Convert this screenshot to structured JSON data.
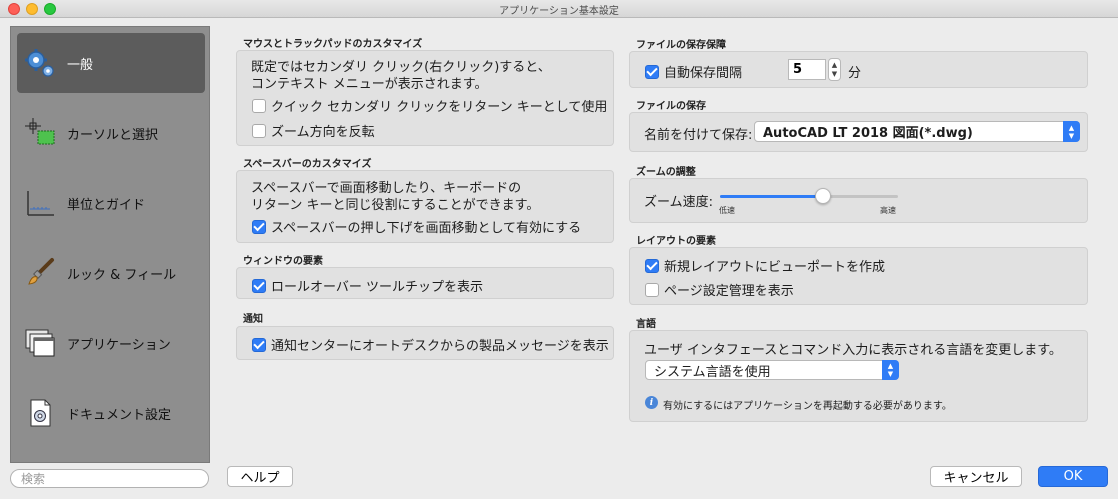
{
  "window": {
    "title": "アプリケーション基本設定"
  },
  "sidebar": {
    "items": [
      {
        "label": "一般",
        "icon": "gear-icon",
        "active": true
      },
      {
        "label": "カーソルと選択",
        "icon": "cursor-icon"
      },
      {
        "label": "単位とガイド",
        "icon": "ruler-icon"
      },
      {
        "label": "ルック & フィール",
        "icon": "brush-icon"
      },
      {
        "label": "アプリケーション",
        "icon": "windows-icon"
      },
      {
        "label": "ドキュメント設定",
        "icon": "document-gear-icon"
      }
    ],
    "search_placeholder": "検索"
  },
  "left": {
    "mouse": {
      "title": "マウスとトラックパッドのカスタマイズ",
      "desc1": "既定ではセカンダリ クリック(右クリック)すると、",
      "desc2": "コンテキスト メニューが表示されます。",
      "opt_quick": "クイック セカンダリ クリックをリターン キーとして使用",
      "opt_zoom_reverse": "ズーム方向を反転"
    },
    "spacebar": {
      "title": "スペースバーのカスタマイズ",
      "desc1": "スペースバーで画面移動したり、キーボードの",
      "desc2": "リターン キーと同じ役割にすることができます。",
      "opt_pan": "スペースバーの押し下げを画面移動として有効にする"
    },
    "window_elements": {
      "title": "ウィンドウの要素",
      "opt_rollover": "ロールオーバー ツールチップを表示"
    },
    "notification": {
      "title": "通知",
      "opt_autodesk": "通知センターにオートデスクからの製品メッセージを表示"
    }
  },
  "right": {
    "autosave": {
      "title": "ファイルの保存保障",
      "opt_label": "自動保存間隔",
      "value": "5",
      "unit": "分"
    },
    "filesave": {
      "title": "ファイルの保存",
      "label": "名前を付けて保存:",
      "selected": "AutoCAD LT 2018 図面(*.dwg)"
    },
    "zoom": {
      "title": "ズームの調整",
      "label": "ズーム速度:",
      "slow": "低速",
      "fast": "高速",
      "level": 0.58
    },
    "layout": {
      "title": "レイアウトの要素",
      "opt_viewport": "新規レイアウトにビューポートを作成",
      "opt_pagesetup": "ページ設定管理を表示"
    },
    "language": {
      "title": "言語",
      "desc": "ユーザ インタフェースとコマンド入力に表示される言語を変更します。",
      "selected": "システム言語を使用",
      "note": "有効にするにはアプリケーションを再起動する必要があります。"
    }
  },
  "buttons": {
    "help": "ヘルプ",
    "cancel": "キャンセル",
    "ok": "OK"
  },
  "colors": {
    "accent": "#2f7cf6",
    "sidebar_bg": "#8e8e8e",
    "sidebar_active": "#5c5c5c"
  }
}
